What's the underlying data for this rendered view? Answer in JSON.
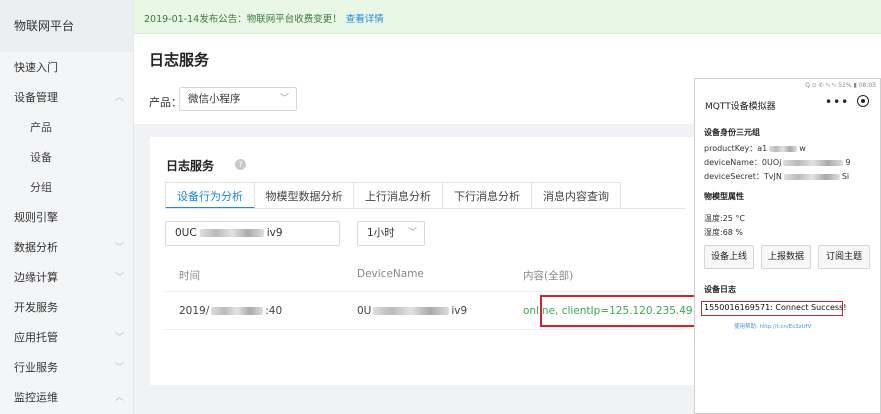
{
  "sidebar": {
    "title": "物联网平台",
    "items": [
      {
        "label": "快速入门",
        "chevron": ""
      },
      {
        "label": "设备管理",
        "chevron": "︿"
      },
      {
        "label": "产品",
        "chevron": ""
      },
      {
        "label": "设备",
        "chevron": ""
      },
      {
        "label": "分组",
        "chevron": ""
      },
      {
        "label": "规则引擎",
        "chevron": ""
      },
      {
        "label": "数据分析",
        "chevron": "﹀"
      },
      {
        "label": "边缘计算",
        "chevron": "﹀"
      },
      {
        "label": "开发服务",
        "chevron": ""
      },
      {
        "label": "应用托管",
        "chevron": "﹀"
      },
      {
        "label": "行业服务",
        "chevron": "﹀"
      },
      {
        "label": "监控运维",
        "chevron": "︿"
      }
    ]
  },
  "notice": {
    "text": "2019-01-14发布公告：物联网平台收费变更！",
    "link": "查看详情"
  },
  "main": {
    "page_title": "日志服务",
    "product_label": "产品：",
    "product_value": "微信小程序",
    "card_title": "日志服务",
    "tabs": [
      "设备行为分析",
      "物模型数据分析",
      "上行消息分析",
      "下行消息分析",
      "消息内容查询"
    ],
    "filter_prefix": "0UC",
    "filter_suffix": "iv9",
    "time_range": "1小时",
    "table": {
      "headers": [
        "时间",
        "DeviceName",
        "内容(全部)"
      ],
      "row": {
        "time_prefix": "2019/",
        "time_suffix": ":40",
        "device_prefix": "0U",
        "device_suffix": "iv9",
        "content": "online, clientIp=125.120.235.49"
      }
    }
  },
  "phone": {
    "status": "Q ⊙ ✆ ᵃᵢₗ ᵃᵢₗ 51% ▮ 08:03",
    "title": "MQTT设备模拟器",
    "dots": "•••",
    "triple_title": "设备身份三元组",
    "product_key": "productKey：a1",
    "product_key_suffix": "w",
    "device_name": "deviceName：0UOj",
    "device_name_suffix": "9",
    "device_secret": "deviceSecret：TvJN",
    "device_secret_suffix": "Si",
    "props_title": "物模型属性",
    "temp": "温度:25    °C",
    "humidity": "湿度:68    %",
    "buttons": [
      "设备上线",
      "上报数据",
      "订阅主题"
    ],
    "log_title": "设备日志",
    "log_line": "1550016169571: Connect Success!",
    "help": "使用帮助: http://t.cn/Ec3zUfV"
  }
}
